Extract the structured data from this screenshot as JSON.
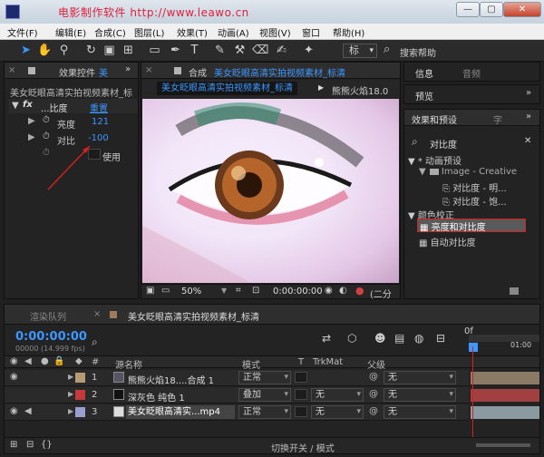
{
  "window": {
    "title": "电影制作软件   http://www.leawo.cn"
  },
  "menu": [
    "文件(F)",
    "编辑(E)",
    "合成(C)",
    "图层(L)",
    "效果(T)",
    "动画(A)",
    "视图(V)",
    "窗口",
    "帮助(H)"
  ],
  "toolbar": {
    "workspace_label": "标",
    "search_label": "搜索帮助"
  },
  "effects_panel": {
    "tab_label": "效果控件",
    "tab_suffix": "美",
    "layer_title": "美女眨眼高清实拍视频素材_标",
    "effect_name": "...比度",
    "reset_label": "重置",
    "brightness_label": "亮度",
    "brightness_value": "121",
    "contrast_label": "对比",
    "contrast_value": "-100",
    "legacy_label": "使用"
  },
  "comp_panel": {
    "tab_label": "合成",
    "tab_name": "美女眨眼高清实拍视频素材_标清",
    "active_tab": "美女眨眼高清实拍视频素材_标清",
    "second_tab": "熊熊火焰18.0",
    "zoom": "50%",
    "timecode": "0:00:00:00",
    "view_label": "(二分"
  },
  "right_panel": {
    "info_tab": "信息",
    "audio_tab": "音频",
    "preview_tab": "预览",
    "effects_tab": "效果和预设",
    "char_tab": "字",
    "search_value": "对比度",
    "tree": {
      "animation_presets": "* 动画预设",
      "image_creative": "Image - Creative",
      "preset1": "对比度 - 明...",
      "preset2": "对比度 - 饱...",
      "color_correction": "颜色校正",
      "item_brightness_contrast": "亮度和对比度",
      "item_auto_contrast": "自动对比度"
    }
  },
  "timeline": {
    "render_tab": "渲染队列",
    "comp_tab": "美女眨眼高清实拍视频素材_标清",
    "timecode": "0:00:00:00",
    "frames": "00000 (14.999 fps)",
    "ruler_start": "0f",
    "ruler_end": "01:00",
    "col_number": "#",
    "col_source": "源名称",
    "col_mode": "模式",
    "col_t": "T",
    "col_trkmat": "TrkMat",
    "col_parent": "父级",
    "footer_label": "切换开关 / 模式",
    "layers": [
      {
        "num": "1",
        "name": "熊熊火焰18....合成 1",
        "mode": "正常",
        "trkmat": "",
        "parent": "无",
        "label_color": "#b89a74"
      },
      {
        "num": "2",
        "name": "深灰色 纯色 1",
        "mode": "叠加",
        "trkmat": "无",
        "parent": "无",
        "label_color": "#c43a3a"
      },
      {
        "num": "3",
        "name": "美女眨眼高清实...mp4",
        "mode": "正常",
        "trkmat": "无",
        "parent": "无",
        "label_color": "#9a9fd0"
      }
    ]
  }
}
